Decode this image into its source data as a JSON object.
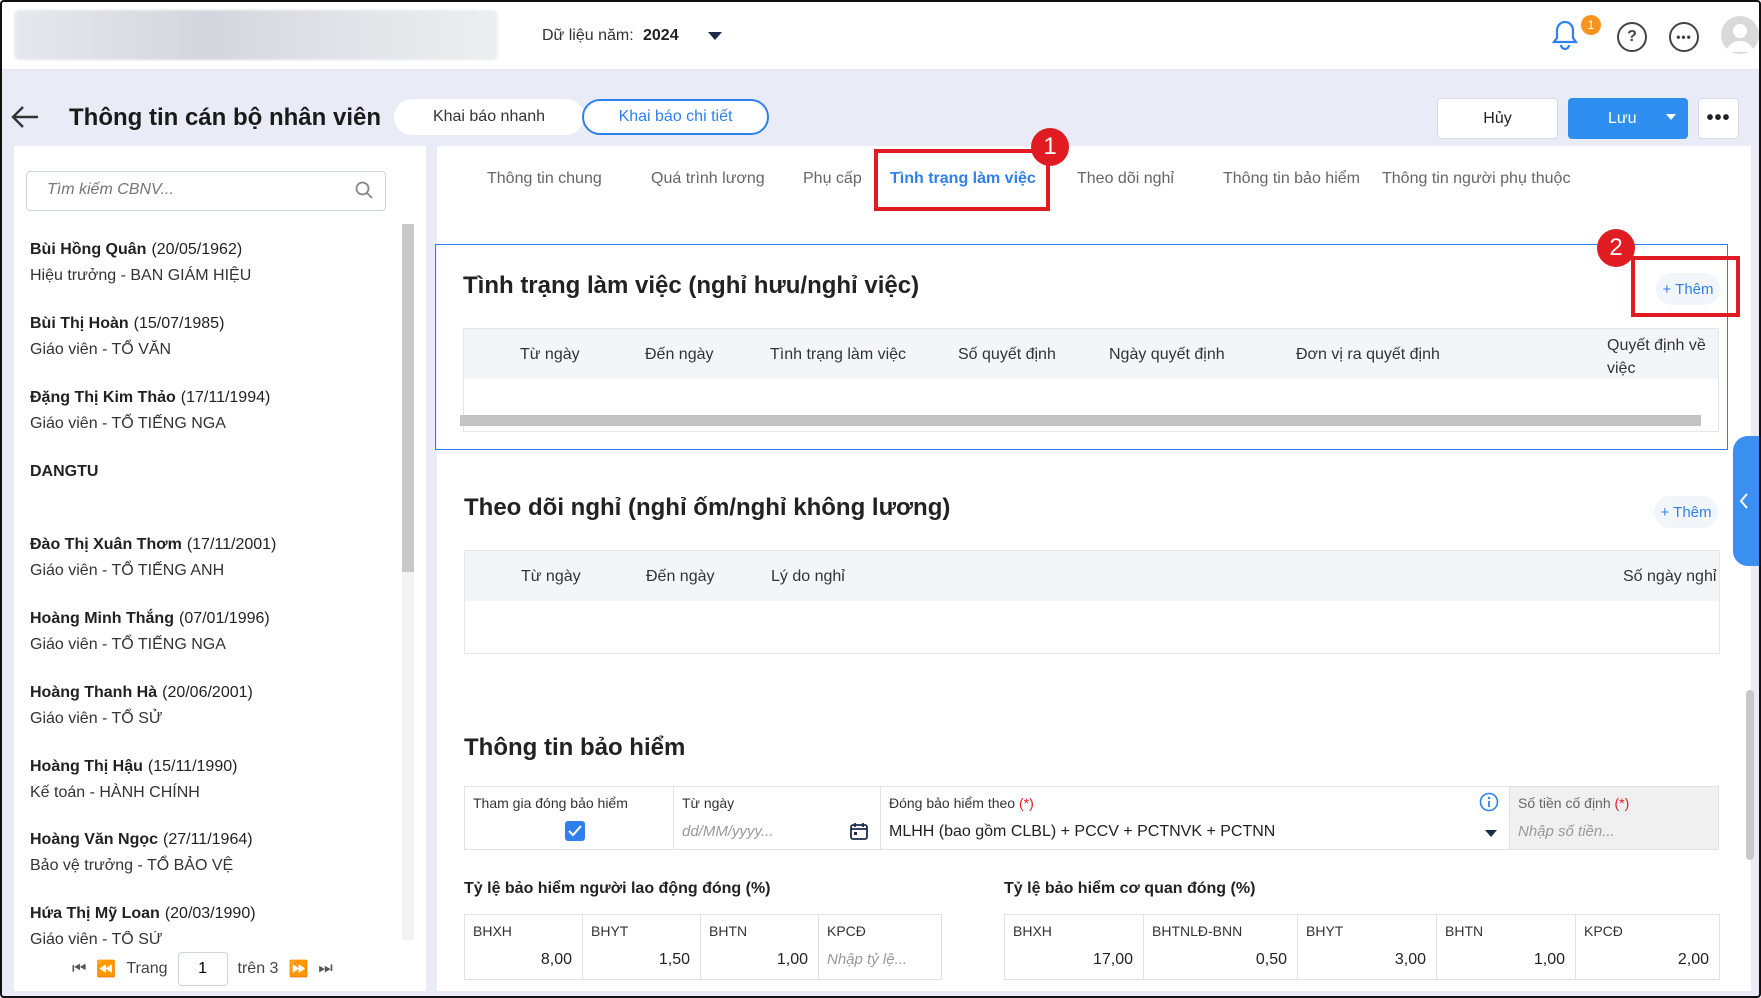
{
  "topbar": {
    "year_label": "Dữ liệu năm:",
    "year_value": "2024",
    "notification_count": "1",
    "help_icon": "question-circle-icon",
    "more_icon": "ellipsis-circle-icon"
  },
  "header": {
    "title": "Thông tin cán bộ nhân viên",
    "mode_quick": "Khai báo nhanh",
    "mode_detail": "Khai báo chi tiết",
    "cancel_label": "Hủy",
    "save_label": "Lưu",
    "more_label": "•••"
  },
  "sidebar": {
    "search_placeholder": "Tìm kiếm CBNV...",
    "employees": [
      {
        "name": "Bùi Hồng Quân",
        "dob": "(20/05/1962)",
        "role": "Hiệu trưởng - BAN GIÁM HIỆU"
      },
      {
        "name": "Bùi Thị Hoàn",
        "dob": "(15/07/1985)",
        "role": "Giáo viên - TỔ VĂN"
      },
      {
        "name": "Đặng Thị Kim Thảo",
        "dob": "(17/11/1994)",
        "role": "Giáo viên - TỔ TIẾNG NGA"
      },
      {
        "name": "DANGTU",
        "dob": "",
        "role": ""
      },
      {
        "name": "Đào Thị Xuân Thơm",
        "dob": "(17/11/2001)",
        "role": "Giáo viên - TỔ TIẾNG ANH"
      },
      {
        "name": "Hoàng Minh Thắng",
        "dob": "(07/01/1996)",
        "role": "Giáo viên - TỔ TIẾNG NGA"
      },
      {
        "name": "Hoàng Thanh Hà",
        "dob": "(20/06/2001)",
        "role": "Giáo viên - TỔ SỬ"
      },
      {
        "name": "Hoàng Thị Hậu",
        "dob": "(15/11/1990)",
        "role": "Kế toán - HÀNH CHÍNH"
      },
      {
        "name": "Hoàng Văn Ngọc",
        "dob": "(27/11/1964)",
        "role": "Bảo vệ trưởng - TỔ BẢO VỆ"
      },
      {
        "name": "Hứa Thị Mỹ Loan",
        "dob": "(20/03/1990)",
        "role": "Giáo viên - TỔ SỬ"
      }
    ],
    "pager": {
      "page_label": "Trang",
      "page_value": "1",
      "total_label": "trên 3"
    }
  },
  "tabs": [
    {
      "label": "Thông tin chung"
    },
    {
      "label": "Quá trình lương"
    },
    {
      "label": "Phụ cấp"
    },
    {
      "label": "Tình trạng làm việc"
    },
    {
      "label": "Theo dõi nghỉ"
    },
    {
      "label": "Thông tin bảo hiểm"
    },
    {
      "label": "Thông tin người phụ thuộc"
    }
  ],
  "markers": [
    "1",
    "2"
  ],
  "work_status": {
    "title": "Tình trạng làm việc (nghỉ hưu/nghỉ việc)",
    "add_label": "+ Thêm",
    "columns": [
      "Từ ngày",
      "Đến ngày",
      "Tình trạng làm việc",
      "Số quyết định",
      "Ngày quyết định",
      "Đơn vị ra quyết định",
      "Quyết định về việc"
    ]
  },
  "leave": {
    "title": "Theo dõi nghỉ (nghỉ ốm/nghỉ không lương)",
    "add_label": "+ Thêm",
    "columns": [
      "Từ ngày",
      "Đến ngày",
      "Lý do nghỉ",
      "Số ngày nghỉ"
    ]
  },
  "insurance": {
    "title": "Thông tin bảo hiểm",
    "participate_label": "Tham gia đóng bảo hiểm",
    "participate_checked": true,
    "from_date_label": "Từ ngày",
    "from_date_placeholder": "dd/MM/yyyy...",
    "basis_label": "Đóng bảo hiểm theo",
    "basis_value": "MLHH (bao gồm CLBL) + PCCV + PCTNVK + PCTNN",
    "fixed_amount_label": "Số tiền cố định",
    "fixed_amount_placeholder": "Nhập số tiền...",
    "required_mark": "(*)",
    "employee_rate_title": "Tỷ lệ bảo hiểm người lao động đóng (%)",
    "employee_rates": [
      {
        "label": "BHXH",
        "value": "8,00"
      },
      {
        "label": "BHYT",
        "value": "1,50"
      },
      {
        "label": "BHTN",
        "value": "1,00"
      },
      {
        "label": "KPCĐ",
        "value": "",
        "placeholder": "Nhập tỷ lệ..."
      }
    ],
    "org_rate_title": "Tỷ lệ bảo hiểm cơ quan đóng (%)",
    "org_rates": [
      {
        "label": "BHXH",
        "value": "17,00"
      },
      {
        "label": "BHTNLĐ-BNN",
        "value": "0,50"
      },
      {
        "label": "BHYT",
        "value": "3,00"
      },
      {
        "label": "BHTN",
        "value": "1,00"
      },
      {
        "label": "KPCĐ",
        "value": "2,00"
      }
    ]
  },
  "colors": {
    "accent": "#2f80ed",
    "highlight": "#e11b22",
    "badge": "#f7941d"
  }
}
